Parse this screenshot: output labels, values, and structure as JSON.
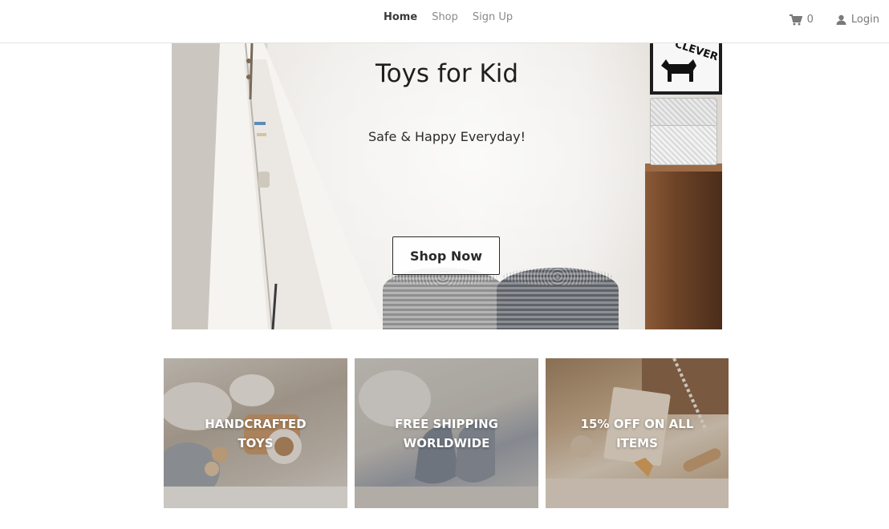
{
  "nav": {
    "items": [
      {
        "label": "Home",
        "active": true
      },
      {
        "label": "Shop",
        "active": false
      },
      {
        "label": "Sign Up",
        "active": false
      }
    ]
  },
  "header": {
    "cart_count": "0",
    "cart_icon": "cart-icon",
    "login_label": "Login",
    "login_icon": "user-icon"
  },
  "hero": {
    "title": "Toys for Kid",
    "subtitle": "Safe & Happy Everyday!",
    "button_label": "Shop Now",
    "frame_text": "CLEVER"
  },
  "features": [
    {
      "label": "HANDCRAFTED TOYS"
    },
    {
      "label": "FREE SHIPPING WORLDWIDE"
    },
    {
      "label": "15% OFF ON ALL ITEMS"
    }
  ],
  "colors": {
    "text_dark": "#1f1f1f",
    "nav_inactive": "#8a8a8a",
    "border": "#e3e3e3"
  }
}
